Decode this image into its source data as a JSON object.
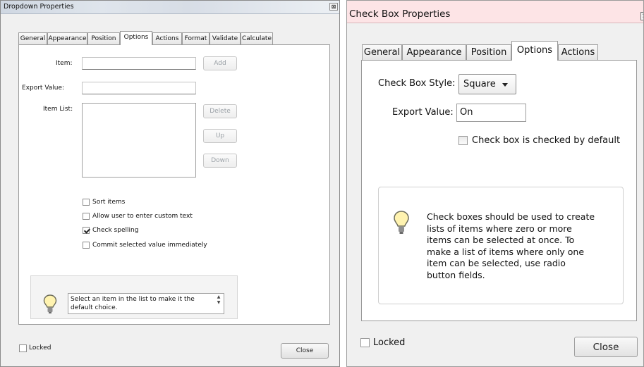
{
  "dropdown_dialog": {
    "title": "Dropdown Properties",
    "close_glyph": "⊠",
    "tabs": [
      "General",
      "Appearance",
      "Position",
      "Options",
      "Actions",
      "Format",
      "Validate",
      "Calculate"
    ],
    "active_tab": "Options",
    "item_label": "Item:",
    "item_value": "",
    "add_button": "Add",
    "export_label": "Export Value:",
    "export_value": "",
    "item_list_label": "Item List:",
    "item_list": [],
    "delete_button": "Delete",
    "up_button": "Up",
    "down_button": "Down",
    "checkboxes": [
      {
        "label": "Sort items",
        "checked": false
      },
      {
        "label": "Allow user to enter custom text",
        "checked": false
      },
      {
        "label": "Check spelling",
        "checked": true
      },
      {
        "label": "Commit selected value immediately",
        "checked": false
      }
    ],
    "tip_text": "Select an item in the list to make it the default choice.",
    "locked_label": "Locked",
    "locked_checked": false,
    "close_button": "Close"
  },
  "checkbox_dialog": {
    "title": "Check Box Properties",
    "tabs": [
      "General",
      "Appearance",
      "Position",
      "Options",
      "Actions"
    ],
    "active_tab": "Options",
    "style_label": "Check Box Style:",
    "style_value": "Square",
    "export_label": "Export Value:",
    "export_value": "On",
    "default_checked_label": "Check box is checked by default",
    "default_checked": false,
    "info_text": "Check boxes should be used to create lists of items where zero or more items can be selected at once. To make a list of items where only one item can be selected, use radio button fields.",
    "locked_label": "Locked",
    "locked_checked": false,
    "close_button": "Close"
  },
  "icons": {
    "tip": "lightbulb-icon",
    "dropdown": "chevron-down-icon"
  },
  "colors": {
    "window_bg": "#f0f0f0",
    "panel_bg": "#ffffff",
    "right_title_bg": "#fde4e6",
    "bulb_fill": "#fff3b0"
  }
}
